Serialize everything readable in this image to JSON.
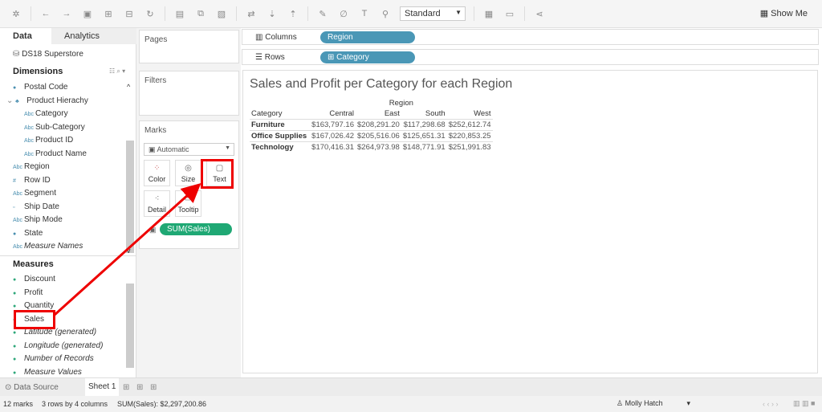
{
  "toolbar": {
    "view_mode": "Standard",
    "show_me": "Show Me"
  },
  "data_pane": {
    "tab_data": "Data",
    "tab_analytics": "Analytics",
    "datasource": "DS18 Superstore",
    "dimensions_title": "Dimensions",
    "dimensions": [
      {
        "label": "Postal Code",
        "icon": "globe-icon",
        "indent": 0
      },
      {
        "label": "Product Hierachy",
        "icon": "hierarchy-icon",
        "indent": 0
      },
      {
        "label": "Category",
        "icon": "abc-icon",
        "indent": 1
      },
      {
        "label": "Sub-Category",
        "icon": "abc-icon",
        "indent": 1
      },
      {
        "label": "Product ID",
        "icon": "abc-icon",
        "indent": 1
      },
      {
        "label": "Product Name",
        "icon": "abc-icon",
        "indent": 1
      },
      {
        "label": "Region",
        "icon": "abc-icon",
        "indent": 0
      },
      {
        "label": "Row ID",
        "icon": "number-icon",
        "indent": 0
      },
      {
        "label": "Segment",
        "icon": "abc-icon",
        "indent": 0
      },
      {
        "label": "Ship Date",
        "icon": "calendar-icon",
        "indent": 0
      },
      {
        "label": "Ship Mode",
        "icon": "abc-icon",
        "indent": 0
      },
      {
        "label": "State",
        "icon": "globe-icon",
        "indent": 0
      },
      {
        "label": "Measure Names",
        "icon": "abc-icon",
        "indent": 0,
        "italic": true
      }
    ],
    "measures_title": "Measures",
    "measures": [
      {
        "label": "Discount"
      },
      {
        "label": "Profit"
      },
      {
        "label": "Quantity"
      },
      {
        "label": "Sales"
      },
      {
        "label": "Latitude (generated)",
        "italic": true
      },
      {
        "label": "Longitude (generated)",
        "italic": true
      },
      {
        "label": "Number of Records",
        "italic": true
      },
      {
        "label": "Measure Values",
        "italic": true
      }
    ]
  },
  "cards": {
    "pages": "Pages",
    "filters": "Filters",
    "marks": "Marks",
    "mark_type": "Automatic",
    "color": "Color",
    "size": "Size",
    "text": "Text",
    "detail": "Detail",
    "tooltip": "Tooltip",
    "pill": "SUM(Sales)"
  },
  "shelves": {
    "columns_label": "Columns",
    "columns_pill": "Region",
    "rows_label": "Rows",
    "rows_pill": "Category"
  },
  "view": {
    "title": "Sales and Profit per Category for each Region",
    "region_header": "Region",
    "category_header": "Category",
    "columns": [
      "Central",
      "East",
      "South",
      "West"
    ],
    "rows": [
      {
        "category": "Furniture",
        "values": [
          "$163,797.16",
          "$208,291.20",
          "$117,298.68",
          "$252,612.74"
        ]
      },
      {
        "category": "Office Supplies",
        "values": [
          "$167,026.42",
          "$205,516.06",
          "$125,651.31",
          "$220,853.25"
        ]
      },
      {
        "category": "Technology",
        "values": [
          "$170,416.31",
          "$264,973.98",
          "$148,771.91",
          "$251,991.83"
        ]
      }
    ]
  },
  "tabs": {
    "data_source": "Data Source",
    "sheet": "Sheet 1"
  },
  "status": {
    "marks": "12 marks",
    "dims": "3 rows by 4 columns",
    "sum": "SUM(Sales): $2,297,200.86",
    "user": "Molly Hatch"
  },
  "annotation_color": "#e00000"
}
